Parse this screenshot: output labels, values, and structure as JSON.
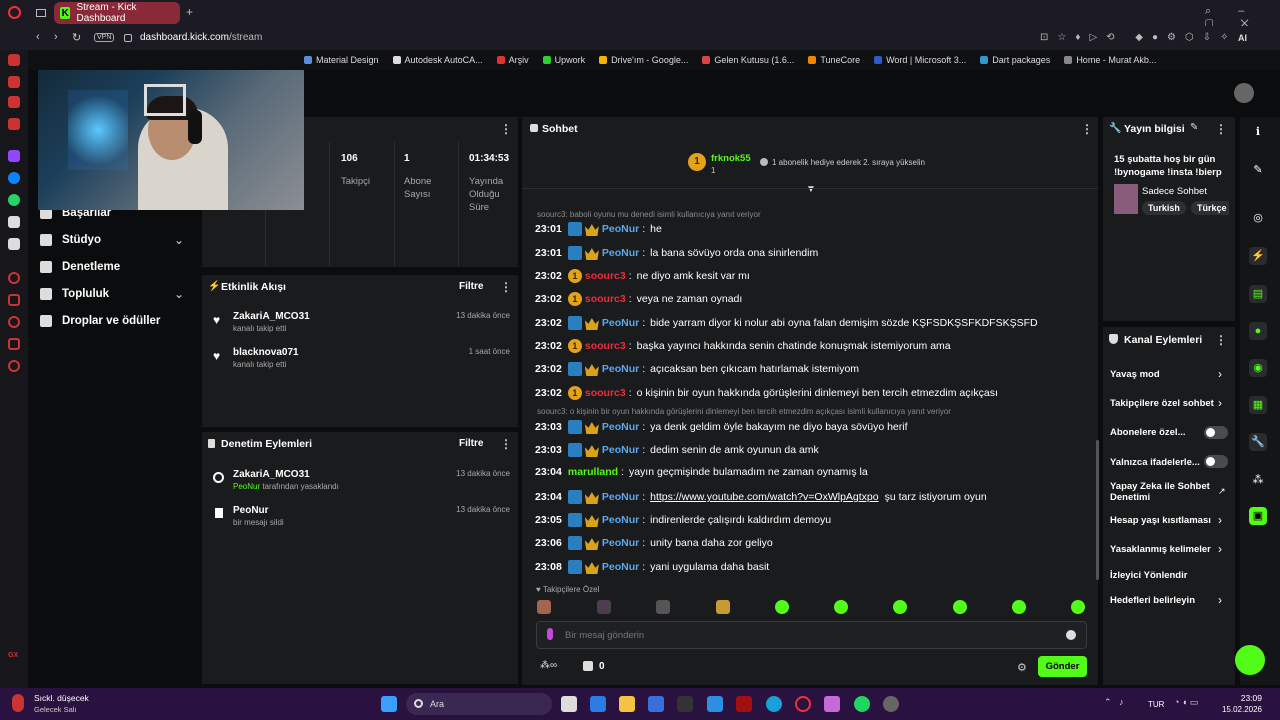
{
  "browser": {
    "tab_title": "Stream - Kick Dashboard",
    "url_host": "dashboard.kick.com",
    "url_path": "/stream",
    "vpn": "VPN",
    "bookmarks": [
      "Material Design",
      "Autodesk AutoCA...",
      "Arşiv",
      "Upwork",
      "Drive'ım - Google...",
      "Gelen Kutusu (1.6...",
      "TuneCore",
      "Word | Microsoft 3...",
      "Dart packages",
      "Home - Murat Akb..."
    ]
  },
  "nav": {
    "items": [
      "Başarılar",
      "Stüdyo",
      "Denetleme",
      "Topluluk",
      "Droplar ve ödüller"
    ]
  },
  "stats": [
    {
      "value": "106",
      "label": "Takipçi"
    },
    {
      "value": "1",
      "label": "Abone Sayısı"
    },
    {
      "value": "01:34:53",
      "label": "Yayında Olduğu Süre"
    }
  ],
  "activity": {
    "title": "Etkinlik Akışı",
    "filter": "Filtre",
    "rows": [
      {
        "name": "ZakariA_MCO31",
        "sub": "kanalı takip etti",
        "time": "13 dakika önce"
      },
      {
        "name": "blacknova071",
        "sub": "kanalı takip etti",
        "time": "1 saat önce"
      }
    ]
  },
  "moderation": {
    "title": "Denetim Eylemleri",
    "filter": "Filtre",
    "rows": [
      {
        "name": "ZakariA_MCO31",
        "sub_user": "PeoNur",
        "sub": "tarafından yasaklandı",
        "time": "13 dakika önce"
      },
      {
        "name": "PeoNur",
        "sub": "bir mesajı sildi",
        "time": "13 dakika önce"
      }
    ]
  },
  "chat": {
    "title": "Sohbet",
    "top_user": "frknok55",
    "top_user_count": "1",
    "gift_text": "1 abonelik hediye ederek 2. sıraya yükselin",
    "reply_1": "soourc3: baboli oyunu mu denedi isimli kullanıcıya yanıt veriyor",
    "reply_2": "soourc3: o kişinin bir oyun hakkında görüşlerini dinlemeyi ben tercih etmezdim açıkçası isimli kullanıcıya yanıt veriyor",
    "messages": [
      {
        "time": "23:01",
        "user": "PeoNur",
        "text": "he"
      },
      {
        "time": "23:01",
        "user": "PeoNur",
        "text": "la bana sövüyo orda ona sinirlendim"
      },
      {
        "time": "23:02",
        "user": "soourc3",
        "text": "ne diyo amk kesit var mı"
      },
      {
        "time": "23:02",
        "user": "soourc3",
        "text": "veya ne zaman oynadı"
      },
      {
        "time": "23:02",
        "user": "PeoNur",
        "text": "bide yarram diyor ki nolur abi oyna falan demişim sözde KŞFSDKŞSFKDFSKŞSFD"
      },
      {
        "time": "23:02",
        "user": "soourc3",
        "text": "başka yayıncı hakkında senin chatinde konuşmak istemiyorum ama"
      },
      {
        "time": "23:02",
        "user": "PeoNur",
        "text": "açıcaksan ben çıkıcam hatırlamak istemiyom"
      },
      {
        "time": "23:02",
        "user": "soourc3",
        "text": "o kişinin bir oyun hakkında görüşlerini dinlemeyi ben tercih etmezdim açıkçası"
      },
      {
        "time": "23:03",
        "user": "PeoNur",
        "text": "ya denk geldim öyle bakayım ne diyo baya sövüyo herif"
      },
      {
        "time": "23:03",
        "user": "PeoNur",
        "text": "dedim senin de amk oyunun da amk"
      },
      {
        "time": "23:04",
        "user": "marulland",
        "text": "yayın geçmişinde bulamadım ne zaman oynamış la"
      },
      {
        "time": "23:04",
        "user": "PeoNur",
        "text": "https://www.youtube.com/watch?v=OxWlpAgtxpo",
        "suffix": "şu tarz istiyorum oyun"
      },
      {
        "time": "23:05",
        "user": "PeoNur",
        "text": "indirenlerde çalışırdı kaldırdım demoyu"
      },
      {
        "time": "23:06",
        "user": "PeoNur",
        "text": "unity bana daha zor geliyo"
      },
      {
        "time": "23:08",
        "user": "PeoNur",
        "text": "yani uygulama daha basit"
      }
    ],
    "followers_label": "Takipçilere Özel",
    "input_placeholder": "Bir mesaj gönderin",
    "counter": "0",
    "send": "Gönder"
  },
  "stream_info": {
    "title": "Yayın bilgisi",
    "stream_title": "15 şubatta hoş bir gün !bynogame !insta !bierp",
    "category": "Sadece Sohbet",
    "tags": [
      "Turkish",
      "Türkçe"
    ]
  },
  "channel_actions": {
    "title": "Kanal Eylemleri",
    "items": [
      "Yavaş mod",
      "Takipçilere özel sohbet",
      "Abonelere özel...",
      "Yalnızca ifadelerle...",
      "Yapay Zeka ile Sohbet Denetimi",
      "Hesap yaşı kısıtlaması",
      "Yasaklanmış kelimeler",
      "İzleyici Yönlendir",
      "Hedefleri belirleyin"
    ]
  },
  "taskbar": {
    "weather_1": "Sıckl. düşecek",
    "weather_2": "Gelecek Salı",
    "search": "Ara",
    "lang": "TUR",
    "time": "23:09",
    "date": "15.02.2026"
  },
  "colors": {
    "accent": "#53fc18",
    "mod_name": "#5aa9f0",
    "viewer_red": "#ee2d3b"
  }
}
